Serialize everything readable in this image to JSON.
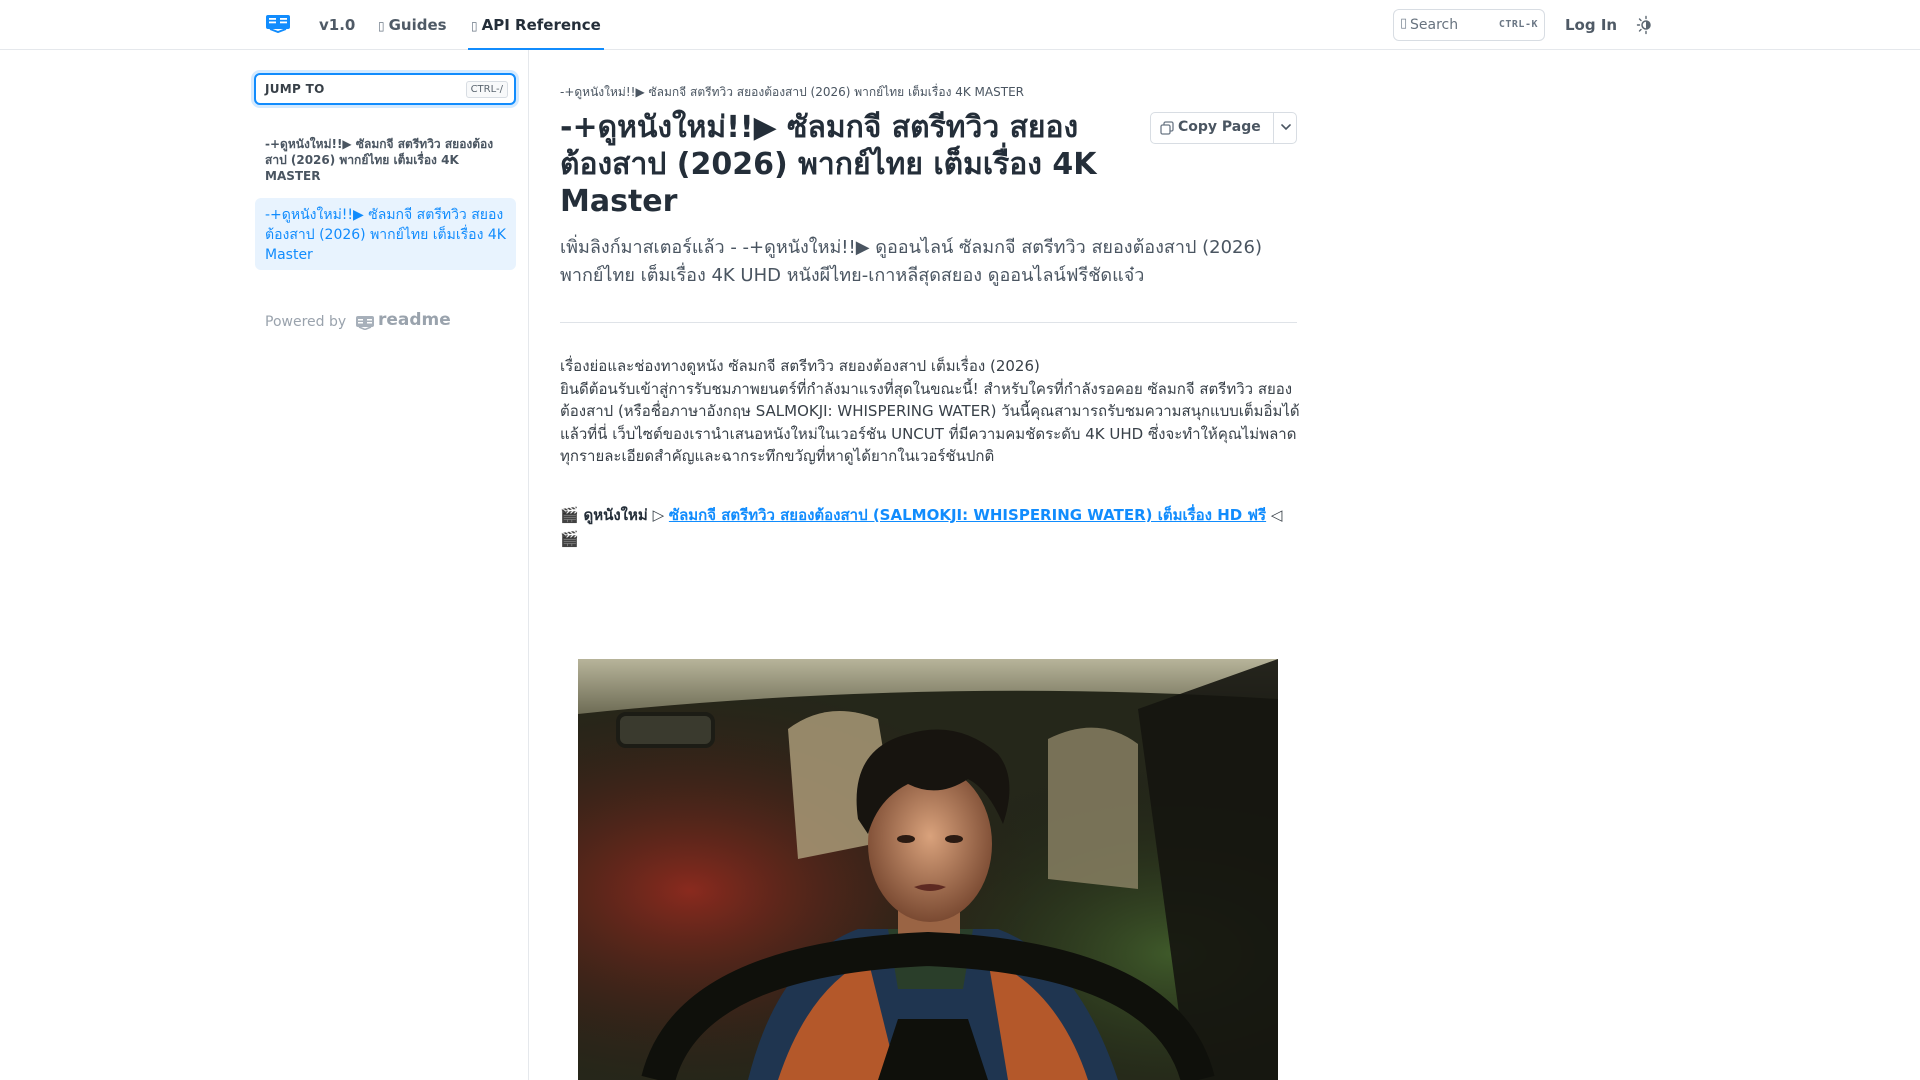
{
  "header": {
    "version": "v1.0",
    "nav": {
      "guides_icon": "book-glyph-icon",
      "guides": "Guides",
      "api_icon": "code-glyph-icon",
      "api_reference": "API Reference"
    },
    "search": {
      "icon": "search-glyph-icon",
      "placeholder": "Search",
      "shortcut": "CTRL-K"
    },
    "login": "Log In",
    "theme_icon": "sun-moon-icon"
  },
  "sidebar": {
    "jump_to": {
      "label": "JUMP TO",
      "shortcut": "CTRL-/"
    },
    "items": [
      {
        "label": "-+ดูหนังใหม่!!▶ ซัลมกจี สตรีทวิว สยองต้องสาป (2026) พากย์ไทย เต็มเรื่อง 4K MASTER",
        "active": false
      },
      {
        "label": "-+ดูหนังใหม่!!▶ ซัลมกจี สตรีทวิว สยองต้องสาป (2026) พากย์ไทย เต็มเรื่อง 4K Master",
        "active": true
      }
    ],
    "powered_by": "Powered by",
    "powered_brand": "readme"
  },
  "main": {
    "breadcrumb": "-+ดูหนังใหม่!!▶ ซัลมกจี สตรีทวิว สยองต้องสาป (2026) พากย์ไทย เต็มเรื่อง 4K MASTER",
    "title": "-+ดูหนังใหม่!!▶ ซัลมกจี สตรีทวิว สยองต้องสาป (2026) พากย์ไทย เต็มเรื่อง 4K Master",
    "copy_page": "Copy Page",
    "subtitle": "เพิ่มลิงก์มาสเตอร์แล้ว - -+ดูหนังใหม่!!▶ ดูออนไลน์ ซัลมกจี สตรีทวิว สยองต้องสาป (2026) พากย์ไทย เต็มเรื่อง 4K UHD หนังผีไทย-เกาหลีสุดสยอง ดูออนไลน์ฟรีชัดแจ๋ว",
    "body_heading": "เรื่องย่อและช่องทางดูหนัง ซัลมกจี สตรีทวิว สยองต้องสาป เต็มเรื่อง (2026)",
    "body_paragraph": "ยินดีต้อนรับเข้าสู่การรับชมภาพยนตร์ที่กำลังมาแรงที่สุดในขณะนี้! สำหรับใครที่กำลังรอคอย ซัลมกจี สตรีทวิว สยองต้องสาป (หรือชื่อภาษาอังกฤษ SALMOKJI: WHISPERING WATER) วันนี้คุณสามารถรับชมความสนุกแบบเต็มอิ่มได้แล้วที่นี่ เว็บไซต์ของเรานำเสนอหนังใหม่ในเวอร์ชัน UNCUT ที่มีความคมชัดระดับ 4K UHD ซึ่งจะทำให้คุณไม่พลาดทุกรายละเอียดสำคัญและฉากระทึกขวัญที่หาดูได้ยากในเวอร์ชันปกติ",
    "watch_prefix_emoji": "🎬",
    "watch_label": "ดูหนังใหม่",
    "watch_arrow_right": "▷",
    "watch_link": "ซัลมกจี สตรีทวิว สยองต้องสาป (SALMOKJI: WHISPERING WATER) เต็มเรื่อง HD ฟรี",
    "watch_arrow_left": "◁",
    "watch_suffix_emoji": "🎬"
  },
  "colors": {
    "accent": "#118cfd",
    "active_bg": "#e8f3fe",
    "title": "#242e39",
    "text": "#384048",
    "border": "#e5e8ec"
  }
}
